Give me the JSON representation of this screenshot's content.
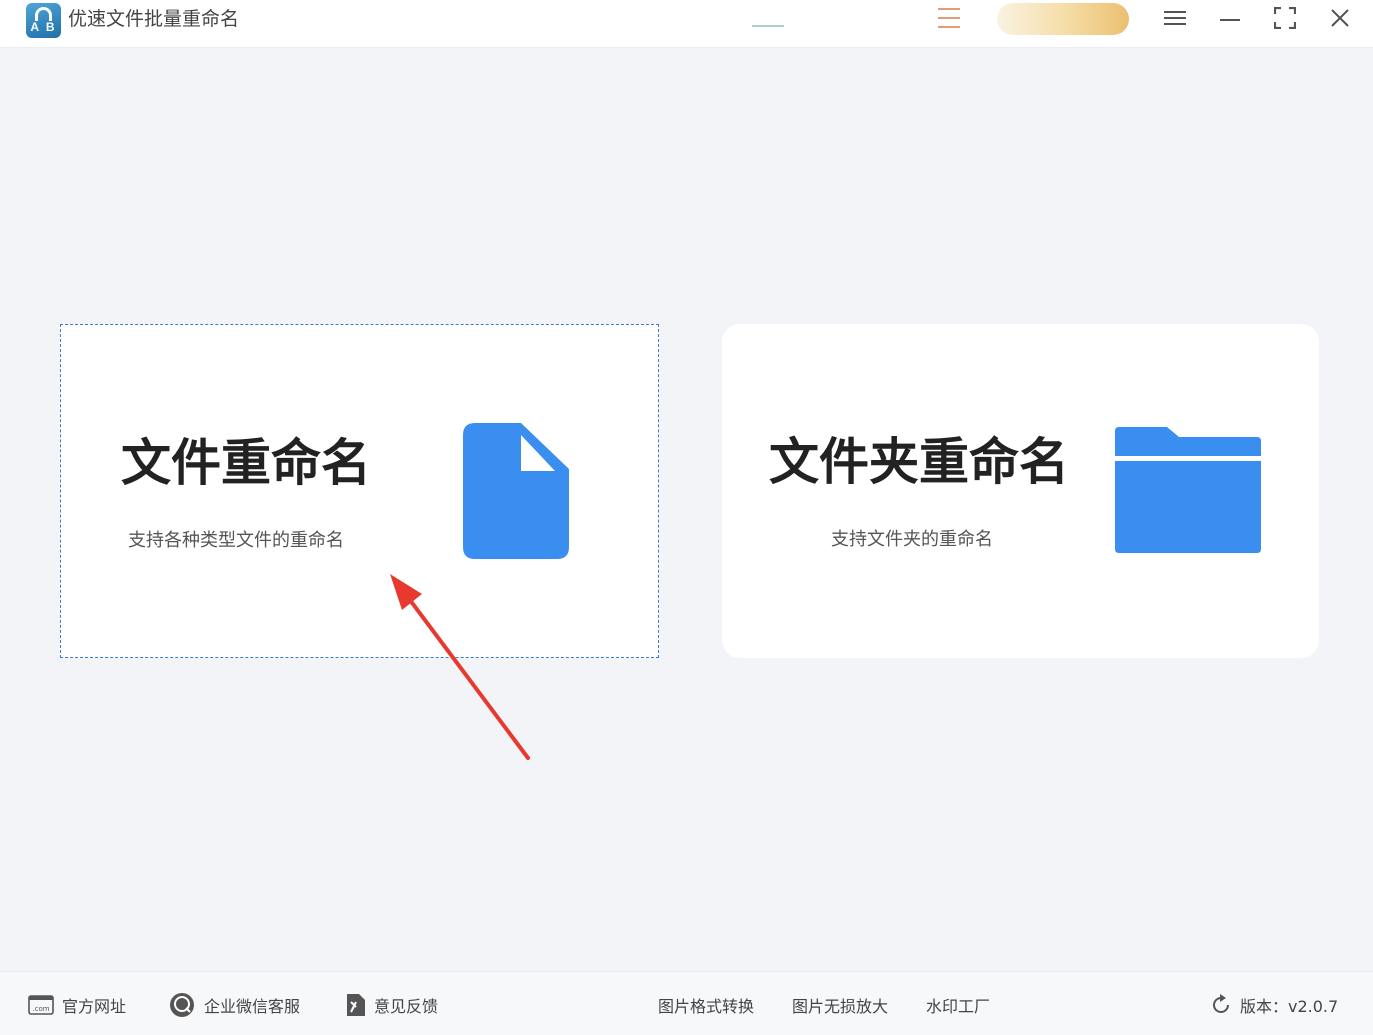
{
  "app": {
    "title": "优速文件批量重命名",
    "logo_text": "A B"
  },
  "titlebar": {
    "menu_icon": "hamburger-menu-icon",
    "minimize_icon": "minimize-icon",
    "maximize_icon": "maximize-icon",
    "close_icon": "close-icon"
  },
  "cards": {
    "file": {
      "title": "文件重命名",
      "description": "支持各种类型文件的重命名",
      "icon": "file-icon",
      "selected": true
    },
    "folder": {
      "title": "文件夹重命名",
      "description": "支持文件夹的重命名",
      "icon": "folder-icon",
      "selected": false
    }
  },
  "footer": {
    "website": "官方网址",
    "wechat_service": "企业微信客服",
    "feedback": "意见反馈",
    "image_convert": "图片格式转换",
    "image_upscale": "图片无损放大",
    "watermark": "水印工厂",
    "version": "版本：v2.0.7"
  },
  "colors": {
    "accent": "#3a8ef0",
    "selection_border": "#3a7bd5",
    "annotation_arrow": "#e8392f",
    "background": "#f3f4f7"
  }
}
